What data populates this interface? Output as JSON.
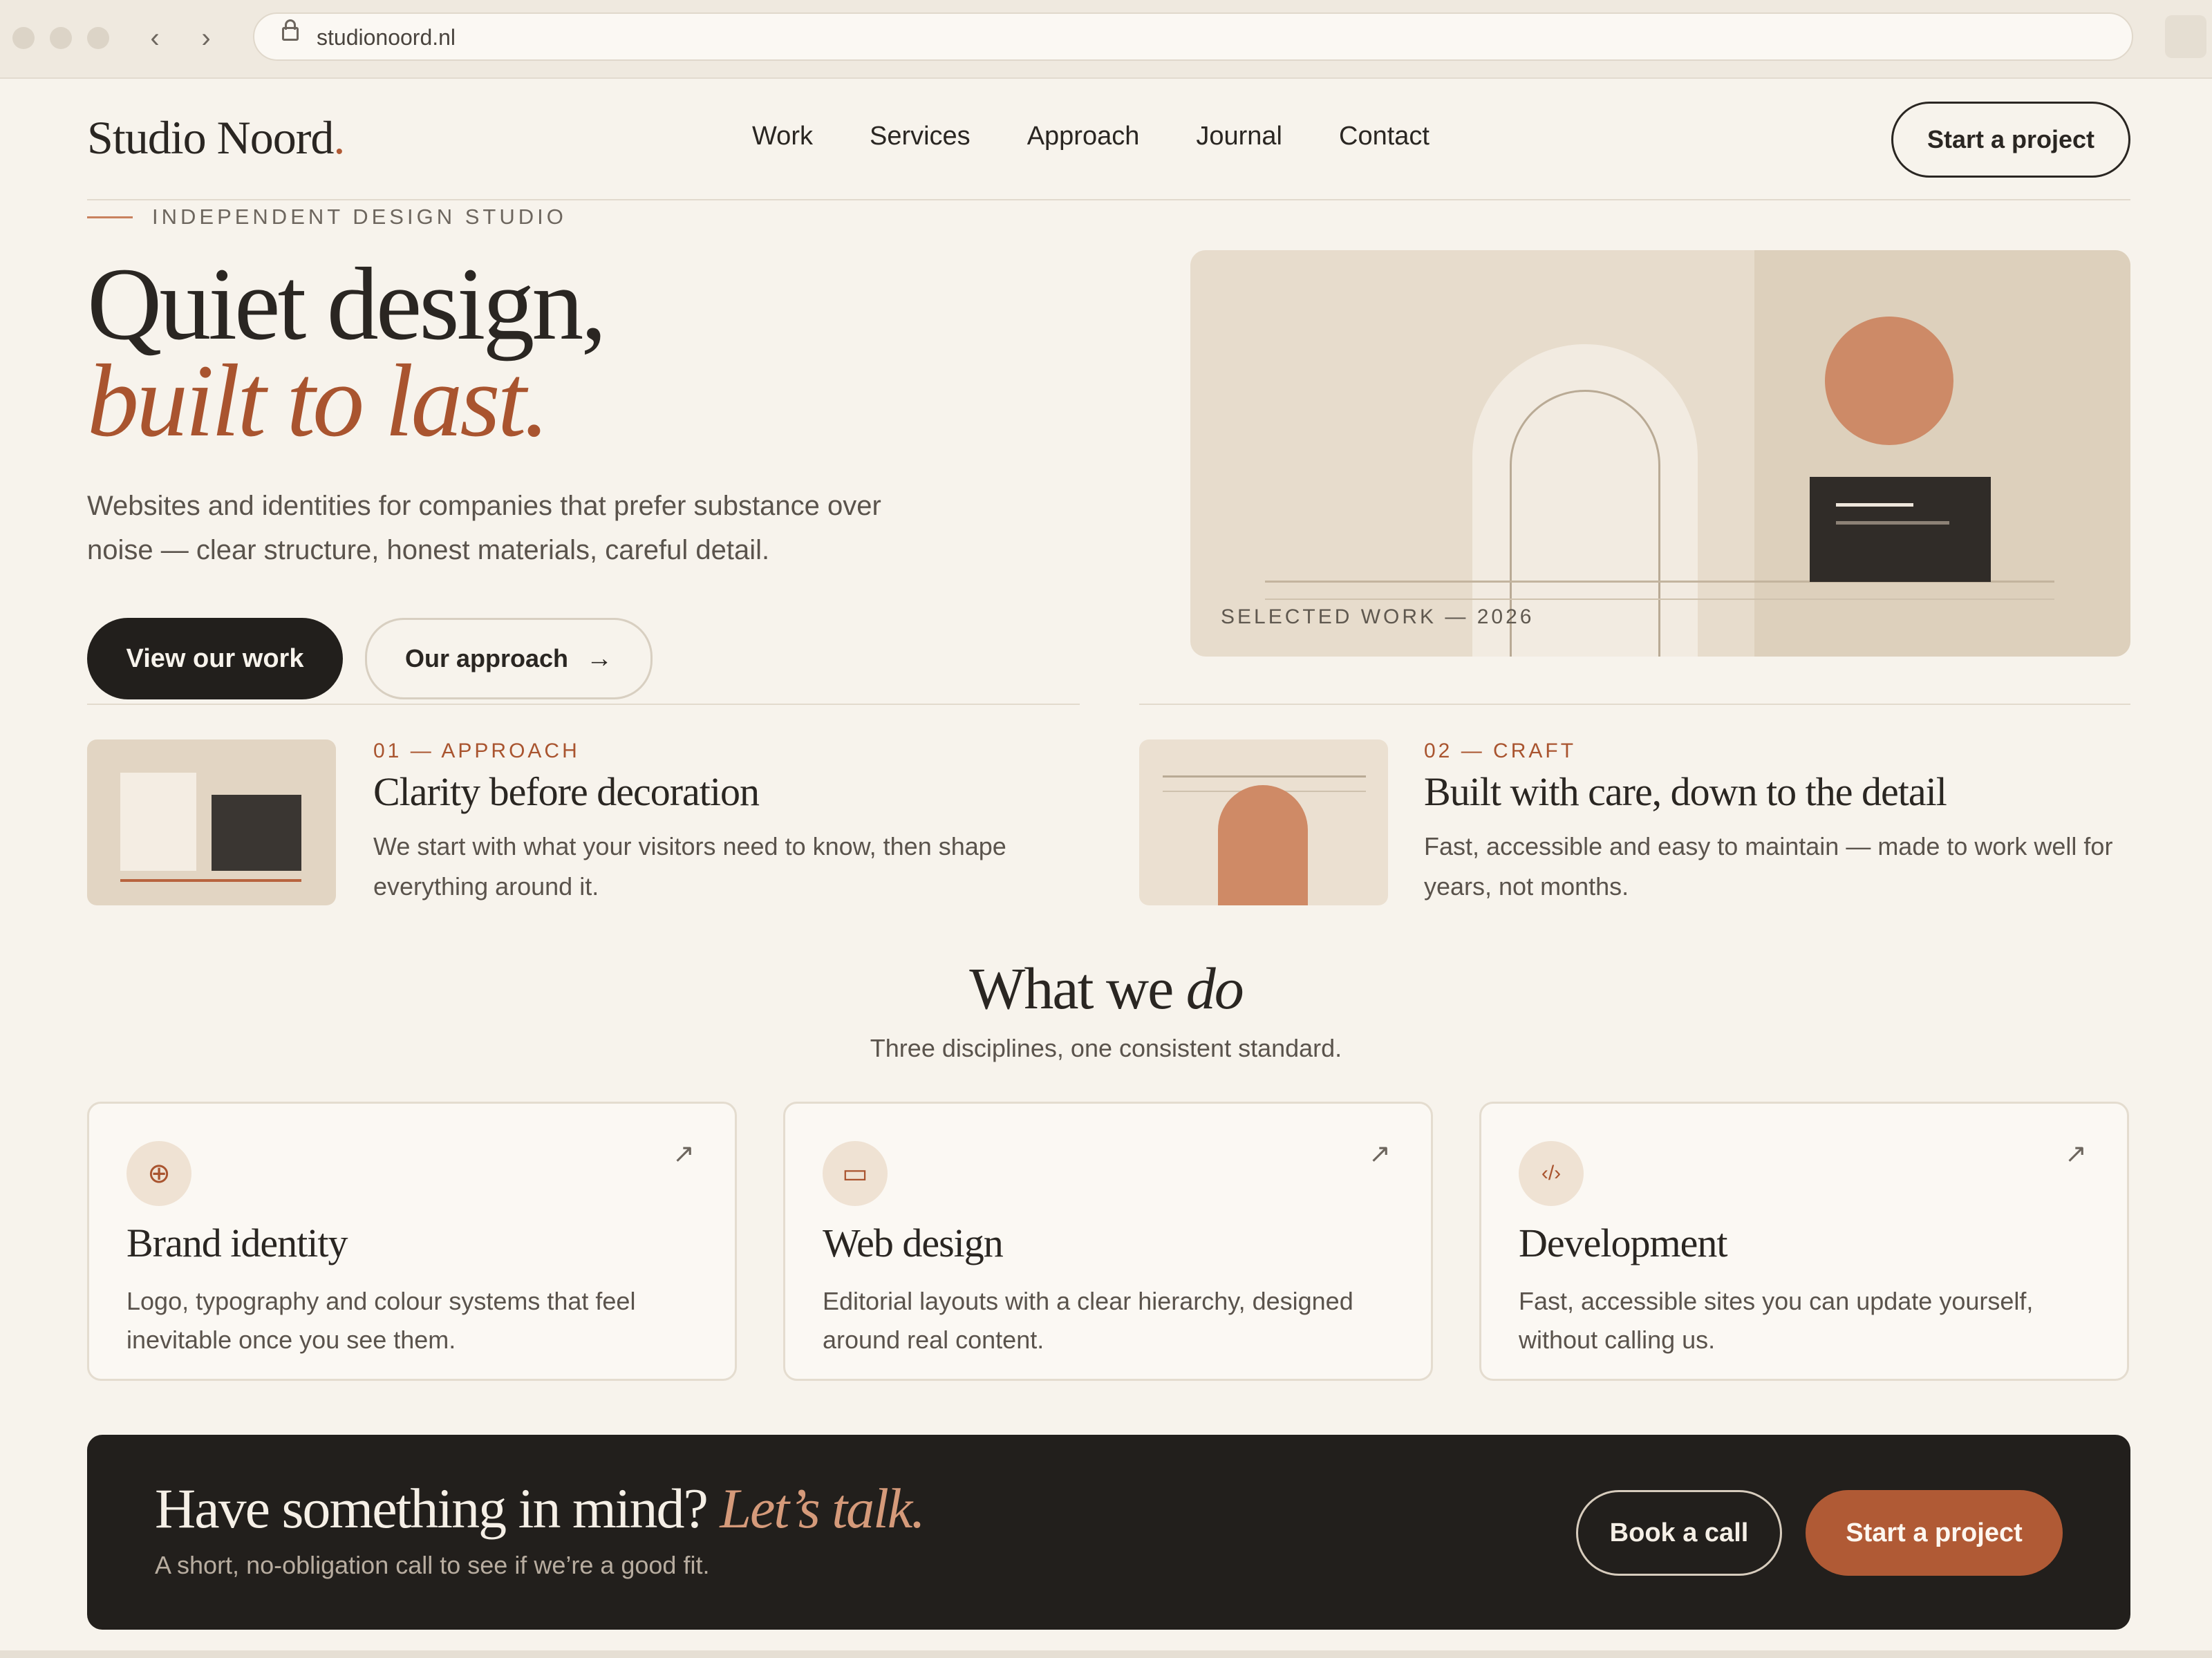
{
  "browser": {
    "url": "studionoord.nl",
    "back_icon": "‹",
    "forward_icon": "›"
  },
  "header": {
    "brand": "Studio Noord",
    "brand_dot": ".",
    "nav": [
      "Work",
      "Services",
      "Approach",
      "Journal",
      "Contact"
    ],
    "cta": "Start a project"
  },
  "hero": {
    "eyebrow": "INDEPENDENT DESIGN STUDIO",
    "title_line1": "Quiet design,",
    "title_line2": "built to last.",
    "lead": "Websites and identities for companies that prefer substance over noise — clear structure, honest materials, careful detail.",
    "primary_button": "View our work",
    "secondary_button": "Our approach",
    "secondary_arrow": "→",
    "art_caption": "SELECTED WORK — 2026"
  },
  "features": [
    {
      "num": "01 — APPROACH",
      "title": "Clarity before decoration",
      "desc": "We start with what your visitors need to know, then shape everything around it."
    },
    {
      "num": "02 — CRAFT",
      "title": "Built with care, down to the detail",
      "desc": "Fast, accessible and easy to maintain — made to work well for years, not months."
    }
  ],
  "services": {
    "title_prefix": "What we ",
    "title_emphasis": "do",
    "subtitle": "Three disciplines, one consistent standard.",
    "cards": [
      {
        "icon": "crosshair-icon",
        "glyph": "⊕",
        "title": "Brand identity",
        "desc": "Logo, typography and colour systems that feel inevitable once you see them.",
        "arrow": "↗"
      },
      {
        "icon": "browser-window-icon",
        "glyph": "▭",
        "title": "Web design",
        "desc": "Editorial layouts with a clear hierarchy, designed around real content.",
        "arrow": "↗"
      },
      {
        "icon": "code-icon",
        "glyph": "‹/›",
        "title": "Development",
        "desc": "Fast, accessible sites you can update yourself, without calling us.",
        "arrow": "↗"
      }
    ]
  },
  "cta": {
    "title": "Have something in mind?",
    "title_accent": "Let’s talk.",
    "subtitle": "A short, no-obligation call to see if we’re a good fit.",
    "secondary_button": "Book a call",
    "primary_button": "Start a project"
  },
  "colors": {
    "background": "#f7f3ec",
    "text": "#2a2622",
    "accent": "#b05a35",
    "dark": "#221f1c"
  }
}
